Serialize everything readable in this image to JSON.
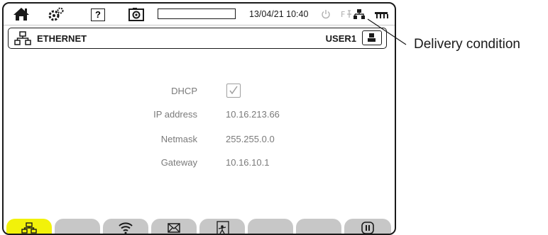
{
  "status_bar": {
    "icons": [
      "home-icon",
      "settings-icon",
      "help-icon",
      "screenshot-icon",
      "power-icon",
      "ethernet-icon",
      "battery-icon"
    ],
    "help_label": "?",
    "datetime": "13/04/21 10:40",
    "progress_percent": 0
  },
  "title_bar": {
    "icon": "ethernet-icon",
    "title": "ETHERNET",
    "user": "USER1"
  },
  "form": {
    "dhcp": {
      "label": "DHCP",
      "checked": true
    },
    "ip_address": {
      "label": "IP address",
      "value": "10.16.213.66"
    },
    "netmask": {
      "label": "Netmask",
      "value": "255.255.0.0"
    },
    "gateway": {
      "label": "Gateway",
      "value": "10.16.10.1"
    }
  },
  "tabs": {
    "items": [
      "ethernet-icon",
      "",
      "wifi-icon",
      "email-icon",
      "web-icon",
      "",
      "",
      "pause-icon"
    ],
    "active_index": 0,
    "active_color": "#f2f20a",
    "inactive_color": "#c7c7c7"
  },
  "callout": {
    "text": "Delivery condition"
  }
}
